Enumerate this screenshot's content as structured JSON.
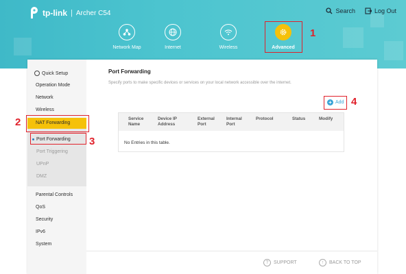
{
  "header": {
    "brand": "tp-link",
    "separator": "|",
    "model": "Archer C54",
    "search_label": "Search",
    "logout_label": "Log Out",
    "nav": [
      {
        "label": "Network Map",
        "icon": "network-map-icon"
      },
      {
        "label": "Internet",
        "icon": "globe-icon"
      },
      {
        "label": "Wireless",
        "icon": "wifi-icon"
      },
      {
        "label": "Advanced",
        "icon": "gear-icon",
        "active": true
      }
    ]
  },
  "callouts": [
    "1",
    "2",
    "3",
    "4"
  ],
  "sidebar": {
    "items": [
      "Quick Setup",
      "Operation Mode",
      "Network",
      "Wireless",
      "NAT Forwarding",
      "Parental Controls",
      "QoS",
      "Security",
      "IPv6",
      "System"
    ],
    "sub_items": [
      "Port Forwarding",
      "Port Triggering",
      "UPnP",
      "DMZ"
    ]
  },
  "main": {
    "title": "Port Forwarding",
    "description": "Specify ports to make specific devices or services on your local network accessible over the internet.",
    "add_label": "Add",
    "table": {
      "headers": [
        [
          "Service",
          "Name"
        ],
        [
          "Device IP",
          "Address"
        ],
        [
          "External",
          "Port"
        ],
        [
          "Internal",
          "Port"
        ],
        [
          "Protocol",
          ""
        ],
        [
          "Status",
          ""
        ],
        [
          "Modify",
          ""
        ]
      ],
      "empty_text": "No Entries in this table."
    }
  },
  "footer": {
    "support_label": "SUPPORT",
    "back_to_top_label": "BACK TO TOP"
  },
  "colors": {
    "header_teal": "#4cc4cf",
    "accent_yellow": "#f5c10a",
    "callout_red": "#e0202a",
    "link_blue": "#3aa4d6"
  }
}
